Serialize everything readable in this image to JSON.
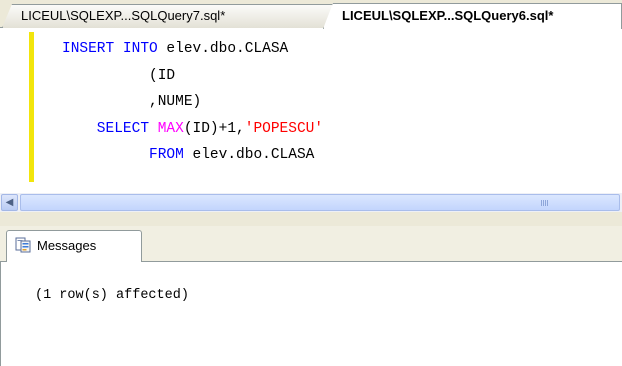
{
  "tabs": [
    {
      "label": "LICEUL\\SQLEXP...SQLQuery7.sql*",
      "active": false
    },
    {
      "label": "LICEUL\\SQLEXP...SQLQuery6.sql*",
      "active": true
    }
  ],
  "editor": {
    "lines": [
      [
        {
          "t": "INSERT INTO ",
          "c": "kw"
        },
        {
          "t": "elev.dbo.CLASA",
          "c": "pl"
        }
      ],
      [
        {
          "t": "          (ID",
          "c": "pl"
        }
      ],
      [
        {
          "t": "          ,NUME)",
          "c": "pl"
        }
      ],
      [
        {
          "t": "    SELECT ",
          "c": "kw"
        },
        {
          "t": "MAX",
          "c": "fn"
        },
        {
          "t": "(ID)+1,",
          "c": "pl"
        },
        {
          "t": "'POPESCU'",
          "c": "str"
        }
      ],
      [
        {
          "t": "          FROM ",
          "c": "kw"
        },
        {
          "t": "elev.dbo.CLASA",
          "c": "pl"
        }
      ]
    ],
    "change_bar_color": "#f2e50c"
  },
  "colors": {
    "keyword": "#0000ff",
    "function": "#ff00ff",
    "string": "#ff0000"
  },
  "results": {
    "tab_label": "Messages",
    "tab_icon": "messages-icon",
    "message": "(1 row(s) affected)"
  },
  "scrollbar": {
    "left_arrow_icon": "scroll-left-arrow-icon"
  }
}
